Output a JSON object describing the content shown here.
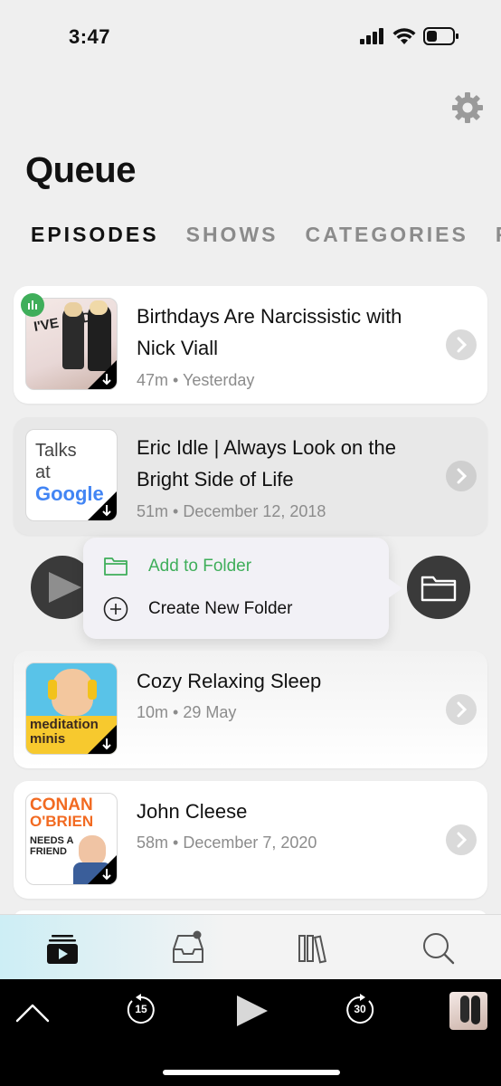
{
  "status": {
    "time": "3:47"
  },
  "header": {
    "title": "Queue"
  },
  "tabs": [
    {
      "label": "EPISODES"
    },
    {
      "label": "SHOWS"
    },
    {
      "label": "CATEGORIES"
    },
    {
      "label": "F"
    }
  ],
  "episodes": [
    {
      "title": "Birthdays Are Narcissistic with Nick Viall",
      "meta": "47m • Yesterday",
      "art_text": "I'VE HAD IT",
      "playing": true
    },
    {
      "title": "Eric Idle | Always Look on the Bright Side of Life",
      "meta": "51m • December 12, 2018",
      "art_line1": "Talks",
      "art_line2": "at",
      "art_line3": "Google"
    },
    {
      "title": "Cozy Relaxing Sleep",
      "meta": "10m • 29 May",
      "art_line1": "meditation",
      "art_line2": "minis"
    },
    {
      "title": "John Cleese",
      "meta": "58m • December 7, 2020",
      "art_line1": "CONAN",
      "art_line2": "O'BRIEN",
      "art_line3": "NEEDS A",
      "art_line4": "FRIEND"
    }
  ],
  "context_menu": {
    "add_to_folder": "Add to Folder",
    "create_new_folder": "Create New Folder"
  },
  "player": {
    "skip_back": "15",
    "skip_forward": "30"
  },
  "colors": {
    "accent_green": "#3fae5a",
    "dark_button": "#3a3a3a"
  }
}
